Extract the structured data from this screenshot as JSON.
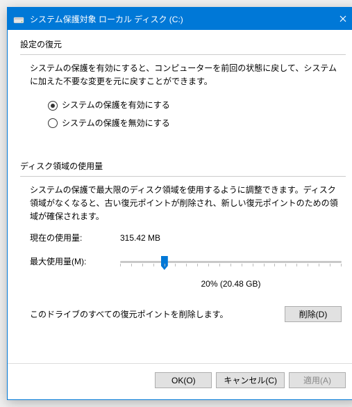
{
  "title": "システム保護対象 ローカル ディスク (C:)",
  "sections": {
    "restore": {
      "header": "設定の復元",
      "desc": "システムの保護を有効にすると、コンピューターを前回の状態に戻して、システムに加えた不要な変更を元に戻すことができます。",
      "radios": {
        "enable": "システムの保護を有効にする",
        "disable": "システムの保護を無効にする",
        "selected": "enable"
      }
    },
    "usage": {
      "header": "ディスク領域の使用量",
      "desc": "システムの保護で最大限のディスク領域を使用するように調整できます。ディスク領域がなくなると、古い復元ポイントが削除され、新しい復元ポイントのための領域が確保されます。",
      "current_label": "現在の使用量:",
      "current_value": "315.42 MB",
      "max_label": "最大使用量(M):",
      "slider": {
        "percent": 20,
        "display": "20% (20.48 GB)"
      },
      "delete_desc": "このドライブのすべての復元ポイントを削除します。",
      "delete_button": "削除(D)"
    }
  },
  "footer": {
    "ok": "OK(O)",
    "cancel": "キャンセル(C)",
    "apply": "適用(A)"
  }
}
